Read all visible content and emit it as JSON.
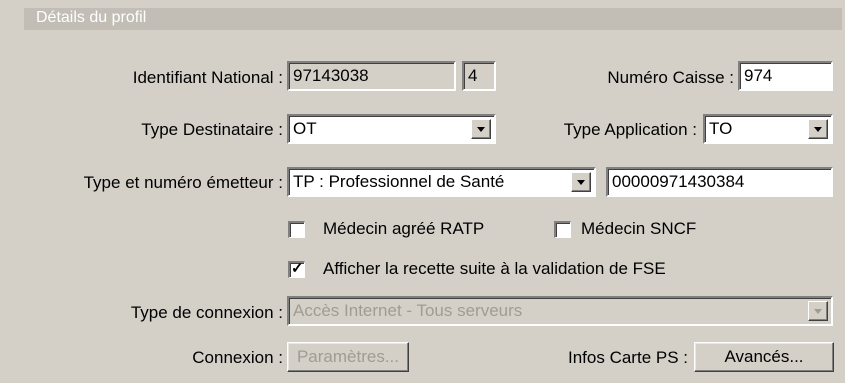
{
  "panel_title": "Détails du profil",
  "identifiant": {
    "label": "Identifiant National :",
    "value": "97143038",
    "key": "4"
  },
  "caisse": {
    "label": "Numéro Caisse :",
    "value": "974"
  },
  "type_destinataire": {
    "label": "Type Destinataire :",
    "value": "OT"
  },
  "type_application": {
    "label": "Type Application :",
    "value": "TO"
  },
  "emetteur": {
    "label": "Type et numéro émetteur :",
    "type_value": "TP : Professionnel de Santé",
    "number_value": "00000971430384"
  },
  "checkboxes": [
    {
      "label": "Médecin agréé RATP",
      "checked": false
    },
    {
      "label": "Médecin SNCF",
      "checked": false
    },
    {
      "label": "Afficher la recette suite à la validation de FSE",
      "checked": true
    }
  ],
  "connexion_type": {
    "label": "Type de connexion :",
    "value": "Accès Internet - Tous serveurs"
  },
  "connexion": {
    "label": "Connexion :",
    "button": "Paramètres..."
  },
  "carte_ps": {
    "label": "Infos Carte PS :",
    "button": "Avancés..."
  }
}
